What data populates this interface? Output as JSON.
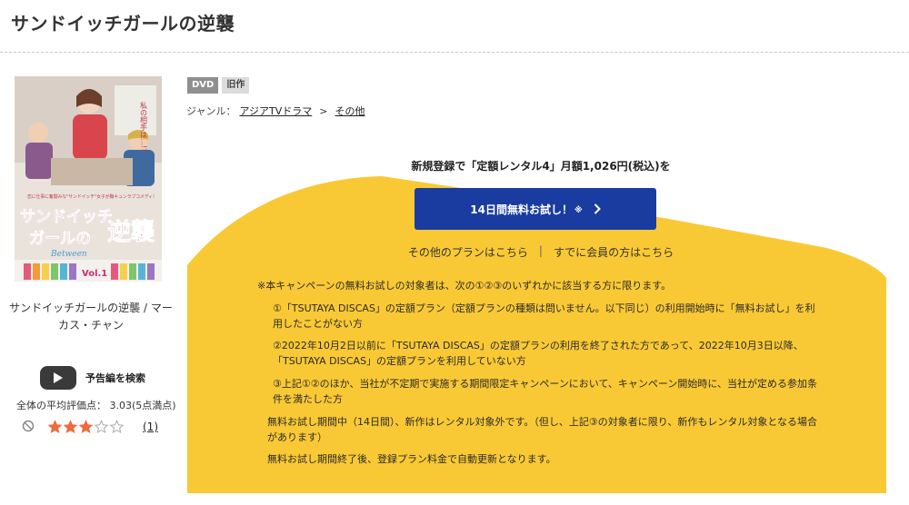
{
  "page": {
    "title": "サンドイッチガールの逆襲"
  },
  "product": {
    "cover": {
      "alt": "サンドイッチガールの逆襲 DVDジャケット",
      "tagline": "恋に仕事に奮闘みな\"サンドイッチ\"女子が胸キュンラブコメディ!",
      "logo_line1": "サンドイッチ",
      "logo_line2": "ガールの",
      "logo_kanji": "逆襲",
      "subtitle": "Between",
      "volume": "Vol.1",
      "speech": "私の相手は…!?"
    },
    "caption": "サンドイッチガールの逆襲 / マーカス・チャン",
    "trailer_label": "予告編を検索",
    "rating": {
      "average_text": "全体の平均評価点： 3.03(5点満点)",
      "value": 3,
      "max": 5,
      "count_label": "(1)"
    },
    "badges": [
      "DVD",
      "旧作"
    ],
    "genre": {
      "label": "ジャンル：",
      "path": [
        "アジアTVドラマ",
        "その他"
      ],
      "separator": ">"
    }
  },
  "promo": {
    "headline": "新規登録で「定額レンタル4」月額1,026円(税込)を",
    "cta_label": "14日間無料お試し！",
    "cta_note": "※",
    "other_plans_link": "その他のプランはこちら",
    "divider": "|",
    "member_link": "すでに会員の方はこちら",
    "terms": {
      "intro": "※本キャンペーンの無料お試しの対象者は、次の①②③のいずれかに該当する方に限ります。",
      "item1": "①「TSUTAYA DISCAS」の定額プラン（定額プランの種類は問いません。以下同じ）の利用開始時に「無料お試し」を利用したことがない方",
      "item2": "②2022年10月2日以前に「TSUTAYA DISCAS」の定額プランの利用を終了された方であって、2022年10月3日以降、「TSUTAYA DISCAS」の定額プランを利用していない方",
      "item3": "③上記①②のほか、当社が不定期で実施する期間限定キャンペーンにおいて、キャンペーン開始時に、当社が定める参加条件を満たした方",
      "period": "無料お試し期間中（14日間）、新作はレンタル対象外です。（但し、上記③の対象者に限り、新作もレンタル対象となる場合があります）",
      "renewal": "無料お試し期間終了後、登録プラン料金で自動更新となります。"
    }
  },
  "colors": {
    "accent_yellow": "#f9c935",
    "cta_blue": "#1a3ba0",
    "star": "#f06a3c"
  }
}
